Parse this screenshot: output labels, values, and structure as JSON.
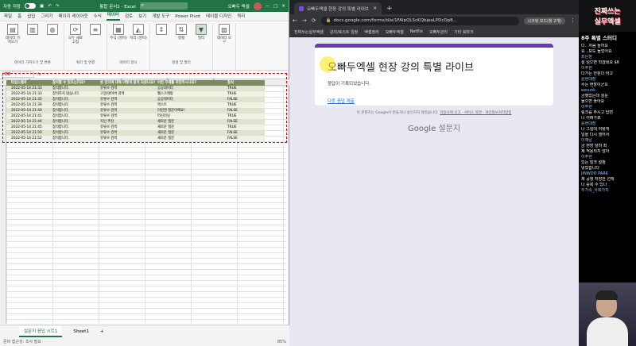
{
  "excel": {
    "title_left": "자동 저장",
    "doc_title": "통합 문서1 - Excel",
    "search_label": "오빠두 엑셀",
    "tabs": [
      "파일",
      "홈",
      "삽입",
      "그리기",
      "페이지 레이아웃",
      "수식",
      "데이터",
      "검토",
      "보기",
      "개발 도구",
      "Power Pivot",
      "테이블 디자인",
      "쿼리"
    ],
    "active_tab": "데이터",
    "ribbon_groups": [
      {
        "label": "데이터 가져오기 및 변환",
        "buttons": [
          "데이터 가져오기",
          "",
          "",
          ""
        ]
      },
      {
        "label": "쿼리 및 연결",
        "buttons": [
          "모두 새로 고침",
          ""
        ]
      },
      {
        "label": "데이터 형식",
        "buttons": [
          "주식 (영어)",
          "지리 (영어)"
        ]
      },
      {
        "label": "정렬 및 필터",
        "buttons": [
          "",
          "정렬",
          "필터",
          ""
        ]
      },
      {
        "label": "",
        "buttons": [
          "데이터 도구",
          ""
        ]
      }
    ],
    "name_box": "D8",
    "fx": "fx",
    "columns": [
      "A",
      "B",
      "C",
      "D",
      "E"
    ],
    "table_headers": [
      "타임스탬프",
      "참석할 수 있으신가요?",
      "본 강의에 대해 어떻게 알게 되셨나요?",
      "어떤 주제를 희망하시나요?",
      "참석"
    ],
    "rows": [
      [
        "2022-05-14 21:33",
        "참석합니다.",
        "유튜브 검색",
        "공공데이터",
        "TRUE"
      ],
      [
        "2022-05-14 21:33",
        "참석하지 않습니다.",
        "구글/네이버 검색",
        "웹스크래핑",
        "TRUE"
      ],
      [
        "2022-05-14 21:35",
        "참석합니다.",
        "유튜브 검색",
        "공공데이터",
        "FALSE"
      ],
      [
        "2022-05-14 21:39",
        "참석합니다.",
        "유튜브 검색",
        "텍스트",
        "TRUE"
      ],
      [
        "2022-05-14 21:40",
        "참석합니다.",
        "유튜브 검색",
        "이번엔 질문이에요!",
        "FALSE"
      ],
      [
        "2022-05-14 21:41",
        "참석합니다.",
        "유튜브 검색",
        "머신러닝",
        "TRUE"
      ],
      [
        "2022-05-14 21:44",
        "참석합니다.",
        "지인 추천",
        "새로운 질문",
        "FALSE"
      ],
      [
        "2022-05-14 21:45",
        "참석합니다.",
        "유튜브 검색",
        "새로운 질문",
        "TRUE"
      ],
      [
        "2022-05-14 21:50",
        "참석합니다.",
        "유튜브 검색",
        "새로운 질문",
        "FALSE"
      ],
      [
        "2022-05-14 21:52",
        "참석합니다.",
        "유튜브 검색",
        "새로운 질문",
        "FALSE"
      ]
    ],
    "sheet_tabs": [
      "설문지 응답 시트1",
      "Sheet1"
    ],
    "sheet_add": "+",
    "status_left": "준비  접근성: 조사 필요",
    "zoom": "85%"
  },
  "chrome": {
    "tab_title": "오빠두엑셀 현장 강의 특별 라이브",
    "new_tab": "+",
    "url": "docs.google.com/forms/d/e/1FAIpQLScKQbjeaLPDcDp8...",
    "profile": "시크릿 모드(창 2개)",
    "bookmarks": [
      "진짜쓰는실무엑셀",
      "강의/로스트 일정",
      "엑셀정리",
      "오빠두엑셀",
      "Netflix",
      "오빠두관리",
      "기타 북마크"
    ],
    "form_title": "오빠두엑셀 현장 강의 특별 라이브",
    "form_message": "응답이 기록되었습니다.",
    "form_link": "다른 응답 제출",
    "disclaimer_text": "이 콘텐츠는 Google이 만들거나 승인하지 않았습니다.",
    "disclaimer_links": "악용사례 신고 · 서비스 약관 · 개인정보처리방침",
    "logo_google": "Google",
    "logo_forms": "설문지"
  },
  "chat": {
    "logo_line1": "진짜쓰는",
    "logo_line2": "실무엑셀",
    "title": "8주 특별 스터디",
    "messages": [
      {
        "user": "",
        "text": "다.. 처음 들어요"
      },
      {
        "user": "",
        "text": "요 ..보도 들었어요"
      },
      {
        "user": "최은정",
        "text": ""
      },
      {
        "user": "",
        "text": "설 넘으면 되겠네요 $6"
      },
      {
        "user": "이주현",
        "text": ""
      },
      {
        "user": "",
        "text": "다가는 안된다 하고"
      },
      {
        "user": "윤현대장",
        "text": ""
      },
      {
        "user": "",
        "text": "수는 현장이군요"
      },
      {
        "user": "eesunk",
        "text": ""
      },
      {
        "user": "",
        "text": "금했었는데 설문"
      },
      {
        "user": "",
        "text": "물으면 좋아요"
      },
      {
        "user": "이주현",
        "text": ""
      },
      {
        "user": "",
        "text": "링크를 주시고 답변"
      },
      {
        "user": "",
        "text": "나 어쩌가죠"
      },
      {
        "user": "윤현대장",
        "text": ""
      },
      {
        "user": "",
        "text": "나 그릴데 어떻게"
      },
      {
        "user": "",
        "text": "일을 다시 열어서"
      },
      {
        "user": "이재남",
        "text": ""
      },
      {
        "user": "",
        "text": "금 현장 살려 최"
      },
      {
        "user": "",
        "text": "제 적용되지 않아"
      },
      {
        "user": "이주현",
        "text": ""
      },
      {
        "user": "",
        "text": "있는 밀크 설정"
      },
      {
        "user": "",
        "text": "넣었습니다"
      },
      {
        "user": "JINWOO PARK",
        "text": ""
      },
      {
        "user": "",
        "text": "제 공정 저장한 선택"
      },
      {
        "user": "",
        "text": "나 중복 수 있나"
      },
      {
        "user": "두가족_사회가치",
        "text": ""
      }
    ]
  }
}
